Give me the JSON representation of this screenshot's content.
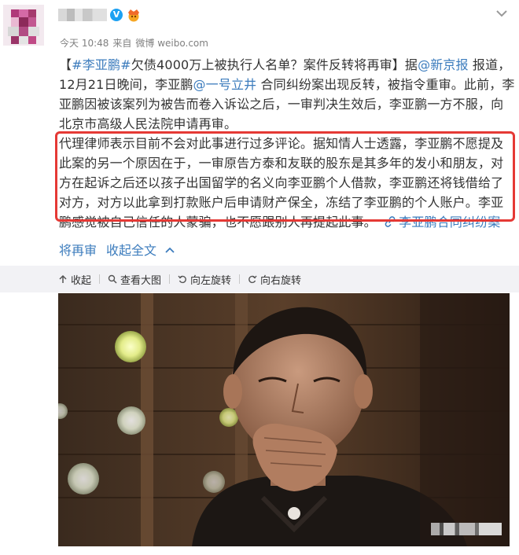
{
  "post": {
    "author_name": "",
    "verified_label": "V",
    "time": "今天 10:48",
    "source_prefix": "来自",
    "source": "微博 weibo.com",
    "more_icon": "chevron-down-icon"
  },
  "content": {
    "line1": {
      "prefix": "【",
      "hashtag": "#李亚鹏#",
      "title": "欠债4000万上被执行人名单？案件反转将再审",
      "suffix": "】",
      "via": "据",
      "mention": "@新京报",
      "tail": " 报道，"
    },
    "line2": {
      "head": "12月21日晚间，李亚鹏",
      "mention": "@一号立井",
      "tail": " 合同纠纷案出现反转，被指令重审。此前，李"
    },
    "line3": "亚鹏因被该案列为被告而卷入诉讼之后，一审判决生效后，李亚鹏一方不服，向",
    "line4": "北京市高级人民法院申请再审。",
    "line5": "代理律师表示目前不会对此事进行过多评论。据知情人士透露，李亚鹏不愿提及",
    "line6": "此案的另一个原因在于，一审原告方泰和友联的股东是其多年的发小和朋友，对",
    "line7": "方在起诉之后还以孩子出国留学的名义向李亚鹏个人借款，李亚鹏还将钱借给了",
    "line8": "对方，对方以此拿到打款账户后申请财产保全，冻结了李亚鹏的个人账户。李亚",
    "line9": {
      "text": "鹏感觉被自己信任的人蒙骗，也不愿跟别人再提起此事。",
      "topic_link": "李亚鹏合同纠纷案"
    },
    "line10": "将再审",
    "collapse_label": "收起全文"
  },
  "toolbar": {
    "collapse": "收起",
    "view_large": "查看大图",
    "rotate_left": "向左旋转",
    "rotate_right": "向右旋转"
  },
  "colors": {
    "link_orange": "#eb7350",
    "link_blue": "#3c7cbd",
    "highlight_red": "#e53935",
    "toolbar_bg": "#f2f2f5"
  }
}
